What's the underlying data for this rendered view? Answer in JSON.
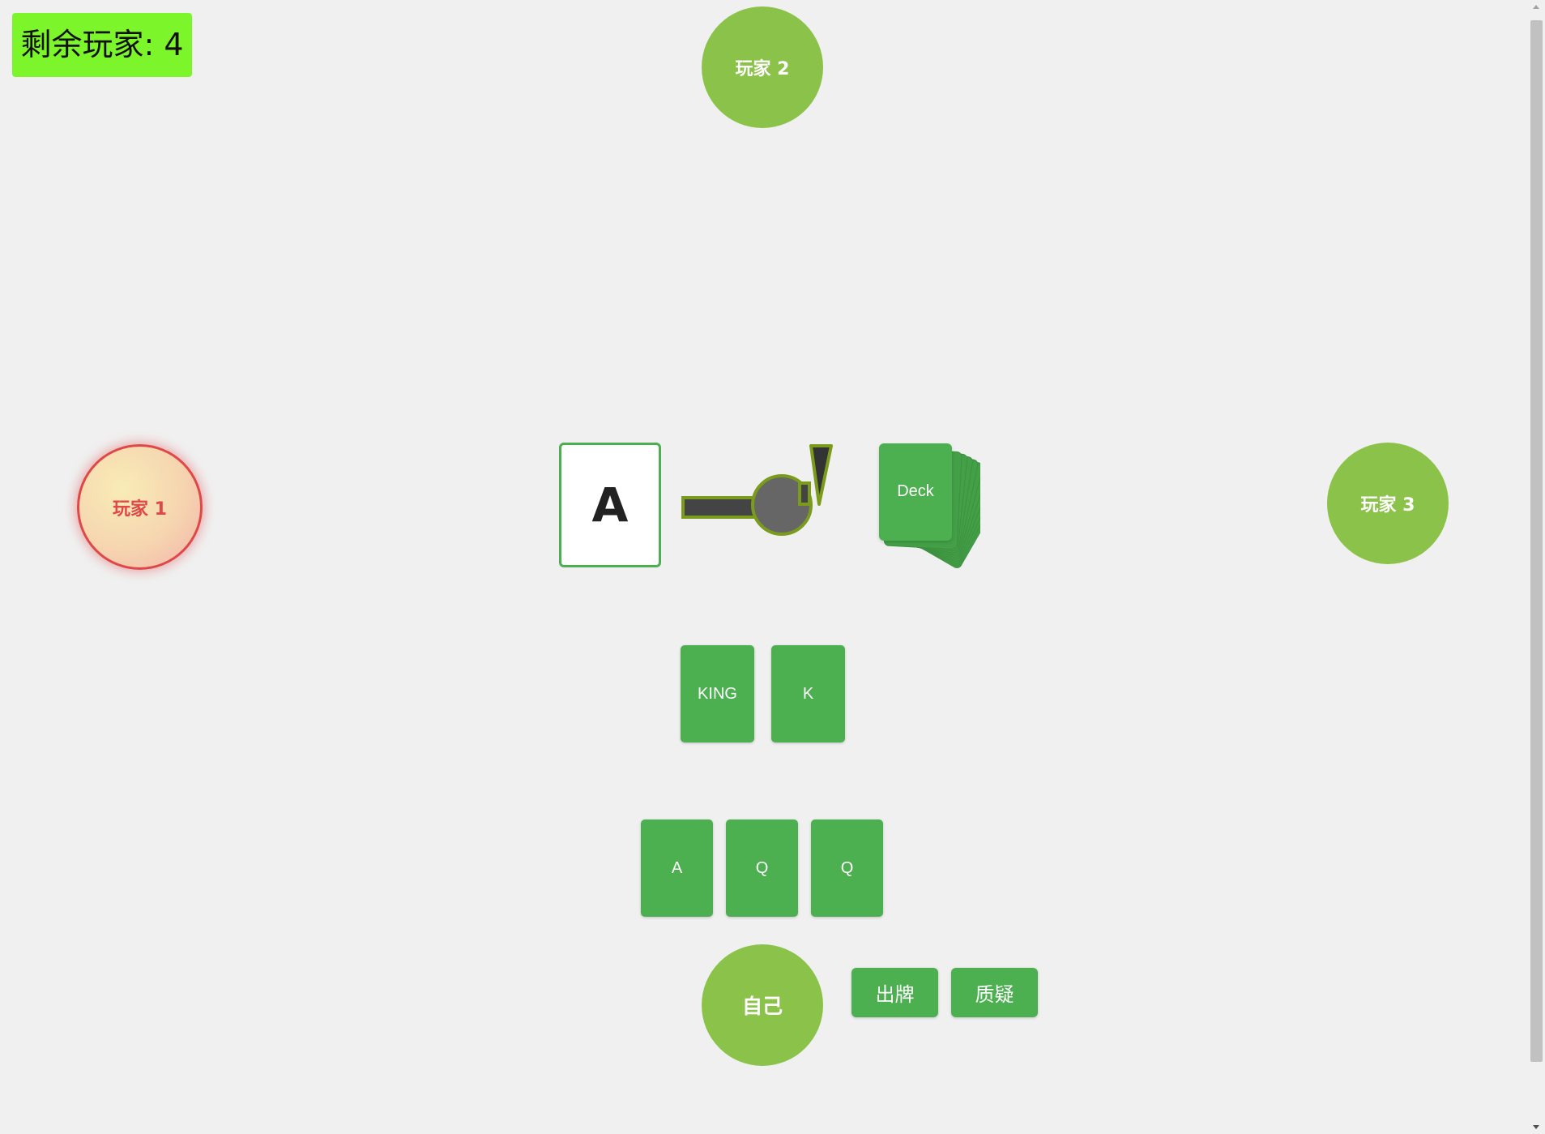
{
  "status": {
    "remaining_players": "剩余玩家: 4"
  },
  "players": {
    "player1": "玩家 1",
    "player2": "玩家 2",
    "player3": "玩家 3",
    "self": "自己"
  },
  "table": {
    "revealed_card": "A",
    "deck_label": "Deck"
  },
  "played_cards": [
    "KING",
    "K"
  ],
  "hand_cards": [
    "A",
    "Q",
    "Q"
  ],
  "actions": {
    "play": "出牌",
    "challenge": "质疑"
  },
  "colors": {
    "card_green": "#4caf50",
    "player_green": "#8bc34a",
    "active_player_border": "#e04848",
    "remaining_badge": "#7cf52a"
  },
  "icons": [
    "revolver-icon",
    "deck-icon"
  ]
}
